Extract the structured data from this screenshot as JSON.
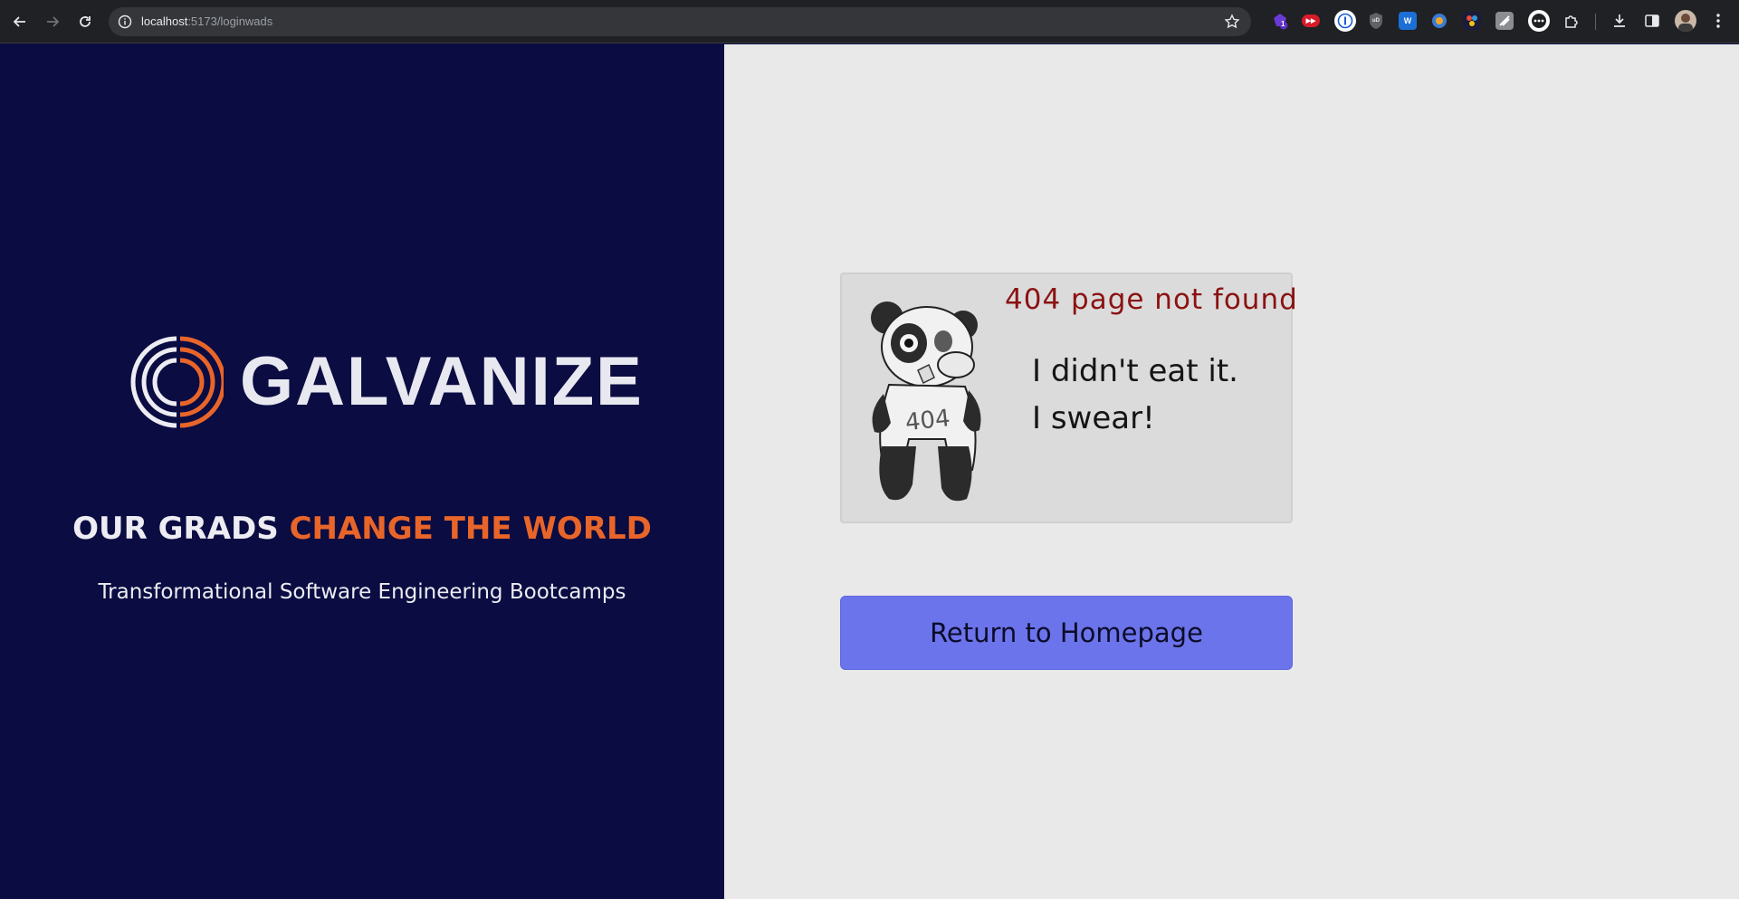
{
  "browser": {
    "url_host": "localhost",
    "url_path": ":5173/loginwads",
    "extension_badge": "1",
    "ext_labels": {
      "ublock": "uD",
      "word": "W",
      "red": "▶▶"
    }
  },
  "brand": {
    "logo_text": "GALVANIZE",
    "tagline_part1": "OUR GRADS ",
    "tagline_part2": "CHANGE THE WORLD",
    "subtagline": "Transformational Software Engineering Bootcamps",
    "colors": {
      "navy": "#0a0c42",
      "orange": "#e8652a",
      "button": "#6b74ea"
    }
  },
  "not_found": {
    "title": "404 page not found",
    "line1": "I didn't eat it.",
    "line2": "I swear!",
    "shirt_text": "404"
  },
  "actions": {
    "return_label": "Return to Homepage"
  }
}
